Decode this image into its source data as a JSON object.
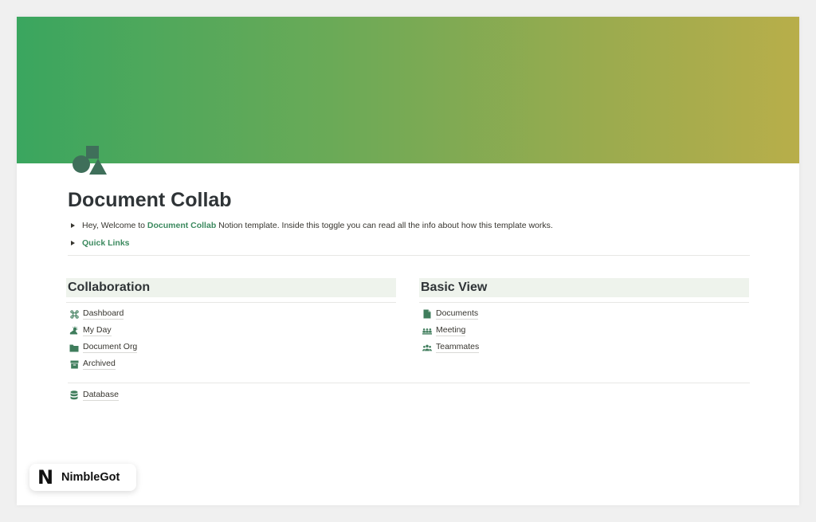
{
  "page": {
    "title": "Document Collab",
    "intro_prefix": "Hey, Welcome to ",
    "intro_link": "Document Collab",
    "intro_suffix": " Notion template. Inside this toggle you can read all the info about how this template works.",
    "quick_links": "Quick Links"
  },
  "collaboration": {
    "header": "Collaboration",
    "items": [
      {
        "label": "Dashboard",
        "icon": "command-icon"
      },
      {
        "label": "My Day",
        "icon": "sun-cloud-icon"
      },
      {
        "label": "Document Org",
        "icon": "folder-icon"
      },
      {
        "label": "Archived",
        "icon": "archive-icon"
      }
    ],
    "database": {
      "label": "Database",
      "icon": "database-icon"
    }
  },
  "basic_view": {
    "header": "Basic View",
    "items": [
      {
        "label": "Documents",
        "icon": "document-icon"
      },
      {
        "label": "Meeting",
        "icon": "meeting-icon"
      },
      {
        "label": "Teammates",
        "icon": "people-icon"
      }
    ]
  },
  "brand": {
    "logo": "N",
    "name": "NimbleGot"
  },
  "colors": {
    "accent_green": "#3c8a5f",
    "icon_green": "#3f7d5c",
    "header_bg": "#eef3ec"
  }
}
